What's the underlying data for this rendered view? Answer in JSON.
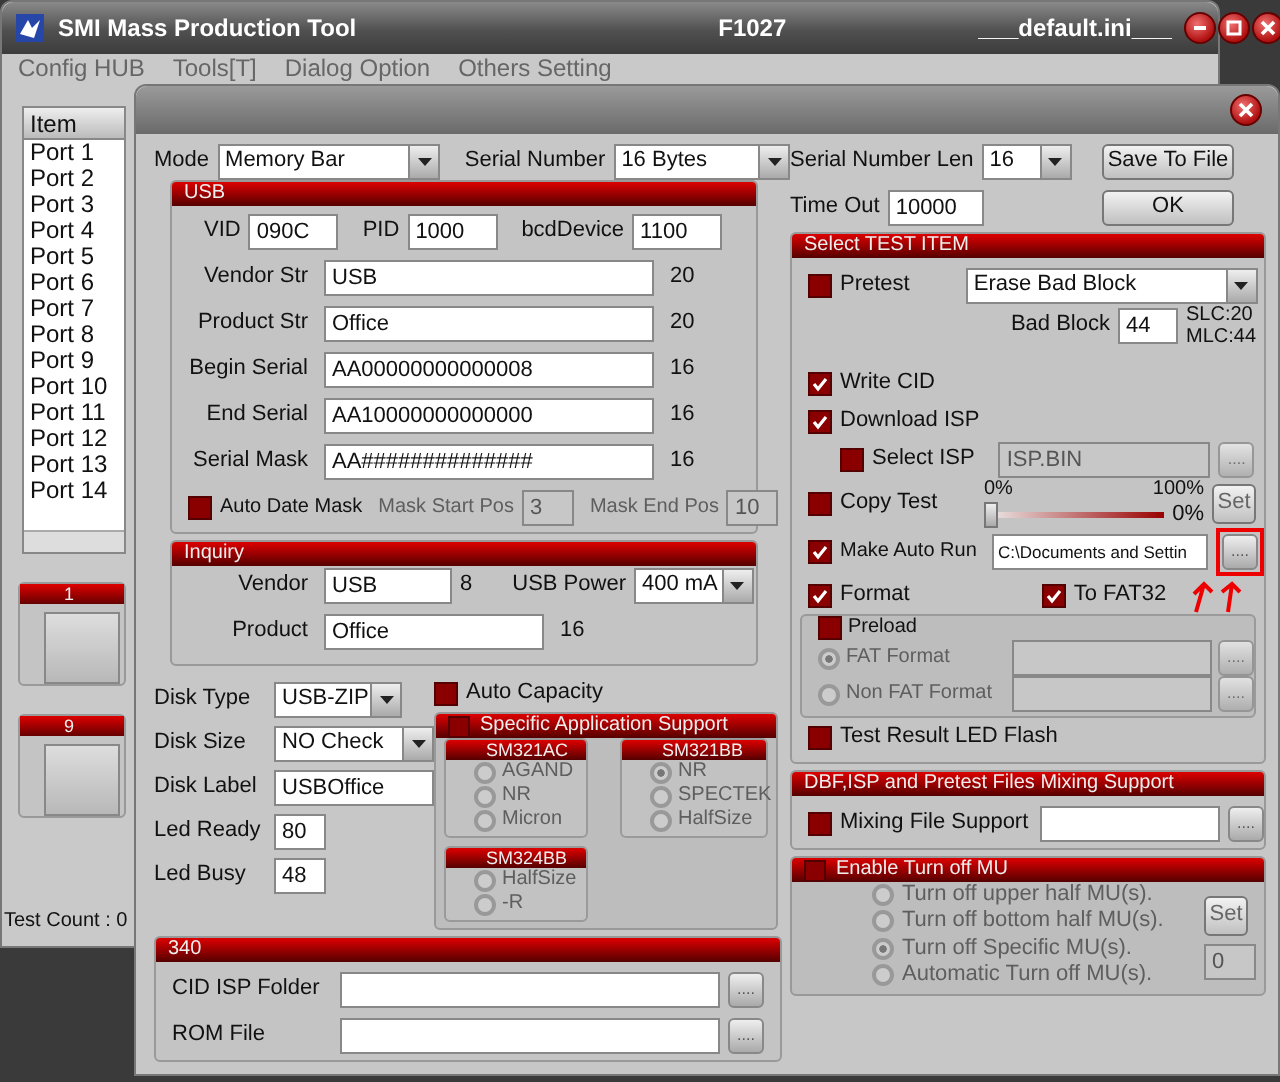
{
  "main_window": {
    "title": "SMI Mass Production Tool",
    "firmware": "F1027",
    "ini_file": "___default.ini___",
    "menu": [
      "Config HUB",
      "Tools[T]",
      "Dialog Option",
      "Others Setting"
    ],
    "port_list": {
      "header": "Item",
      "items": [
        "Port 1",
        "Port 2",
        "Port 3",
        "Port 4",
        "Port 5",
        "Port 6",
        "Port 7",
        "Port 8",
        "Port 9",
        "Port 10",
        "Port 11",
        "Port 12",
        "Port 13",
        "Port 14"
      ]
    },
    "port_groups": [
      {
        "label": "1"
      },
      {
        "label": "9"
      }
    ],
    "test_count": "Test Count : 0"
  },
  "dialog": {
    "top": {
      "mode": {
        "label": "Mode",
        "value": "Memory Bar"
      },
      "serial_number": {
        "label": "Serial Number",
        "value": "16 Bytes"
      },
      "serial_number_len": {
        "label": "Serial Number Len",
        "value": "16"
      },
      "time_out": {
        "label": "Time Out",
        "value": "10000"
      },
      "buttons": [
        "Save To File",
        "OK"
      ]
    },
    "usb": {
      "title": "USB",
      "ids": [
        {
          "label": "VID",
          "value": "090C"
        },
        {
          "label": "PID",
          "value": "1000"
        },
        {
          "label": "bcdDevice",
          "value": "1100"
        }
      ],
      "strings": [
        {
          "label": "Vendor Str",
          "value": "USB",
          "length": "20"
        },
        {
          "label": "Product Str",
          "value": "Office",
          "length": "20"
        },
        {
          "label": "Begin Serial",
          "value": "AA00000000000008",
          "length": "16"
        },
        {
          "label": "End Serial",
          "value": "AA10000000000000",
          "length": "16"
        },
        {
          "label": "Serial Mask",
          "value": "AA##############",
          "length": "16"
        }
      ],
      "auto_date_mask": {
        "label": "Auto Date Mask",
        "checked": false
      },
      "mask_fields": [
        {
          "label": "Mask Start Pos",
          "value": "3",
          "disabled": true
        },
        {
          "label": "Mask End Pos",
          "value": "10",
          "disabled": true
        }
      ]
    },
    "inquiry": {
      "title": "Inquiry",
      "vendor": {
        "label": "Vendor",
        "value": "USB",
        "length": "8"
      },
      "usb_power": {
        "label": "USB Power",
        "value": "400 mA"
      },
      "product": {
        "label": "Product",
        "value": "Office",
        "length": "16"
      }
    },
    "disk": [
      {
        "kind": "dropdown",
        "label": "Disk Type",
        "value": "USB-ZIP"
      },
      {
        "kind": "dropdown",
        "label": "Disk Size",
        "value": "NO Check"
      },
      {
        "kind": "text",
        "label": "Disk Label",
        "value": "USBOffice"
      },
      {
        "kind": "short",
        "label": "Led Ready",
        "value": "80"
      },
      {
        "kind": "short",
        "label": "Led Busy",
        "value": "48"
      }
    ],
    "auto_capacity": {
      "label": "Auto Capacity",
      "checked": false
    },
    "specific_support": {
      "title": "Specific Application Support",
      "checked": false,
      "disabled": true,
      "groups": [
        {
          "title": "SM321AC",
          "options": [
            {
              "label": "AGAND",
              "selected": false
            },
            {
              "label": "NR",
              "selected": false
            },
            {
              "label": "Micron",
              "selected": false
            }
          ]
        },
        {
          "title": "SM321BB",
          "options": [
            {
              "label": "NR",
              "selected": true
            },
            {
              "label": "SPECTEK",
              "selected": false
            },
            {
              "label": "HalfSize",
              "selected": false
            }
          ]
        },
        {
          "title": "SM324BB",
          "options": [
            {
              "label": "HalfSize",
              "selected": false
            },
            {
              "label": "-R",
              "selected": false
            }
          ]
        }
      ]
    },
    "group_340": {
      "title": "340",
      "fields": [
        {
          "label": "CID ISP Folder",
          "browse": "...."
        },
        {
          "label": "ROM File",
          "browse": "...."
        }
      ]
    },
    "test_items": {
      "title": "Select TEST ITEM",
      "pretest": {
        "label": "Pretest",
        "checked": false,
        "value": "Erase Bad Block"
      },
      "bad_block": {
        "label": "Bad Block",
        "value": "44",
        "slc": "SLC:20",
        "mlc": "MLC:44"
      },
      "write_cid": {
        "label": "Write CID",
        "checked": true
      },
      "download_isp": {
        "label": "Download ISP",
        "checked": true
      },
      "select_isp": {
        "label": "Select ISP",
        "checked": false,
        "value": "ISP.BIN",
        "browse": "....",
        "disabled": true
      },
      "copy_test": {
        "label": "Copy Test",
        "checked": false,
        "min_label": "0%",
        "max_label": "100%",
        "reading": "0%",
        "level": 0,
        "button": "Set",
        "disabled": true
      },
      "make_auto_run": {
        "label": "Make Auto Run",
        "checked": true,
        "value": "C:\\Documents and Settin",
        "browse": "....",
        "highlighted": true
      },
      "format": {
        "label": "Format",
        "checked": true
      },
      "to_fat32": {
        "label": "To FAT32",
        "checked": true
      },
      "preload": {
        "label": "Preload",
        "checked": false,
        "disabled": true,
        "options": [
          {
            "label": "FAT Format",
            "selected": true,
            "browse": "...."
          },
          {
            "label": "Non FAT Format",
            "selected": false,
            "browse": "...."
          }
        ]
      },
      "led_flash": {
        "label": "Test Result LED Flash",
        "checked": false
      }
    },
    "mixing": {
      "title": "DBF,ISP and Pretest Files Mixing Support",
      "label": "Mixing File Support",
      "checked": false,
      "browse": "...."
    },
    "turn_off_mu": {
      "title": "Enable Turn off MU",
      "checked": false,
      "disabled": true,
      "options": [
        {
          "label": "Turn off upper half MU(s).",
          "selected": false
        },
        {
          "label": "Turn off bottom half MU(s).",
          "selected": false
        },
        {
          "label": "Turn off Specific MU(s).",
          "selected": true
        },
        {
          "label": "Automatic Turn off MU(s).",
          "selected": false
        }
      ],
      "button": "Set",
      "value": "0"
    }
  }
}
